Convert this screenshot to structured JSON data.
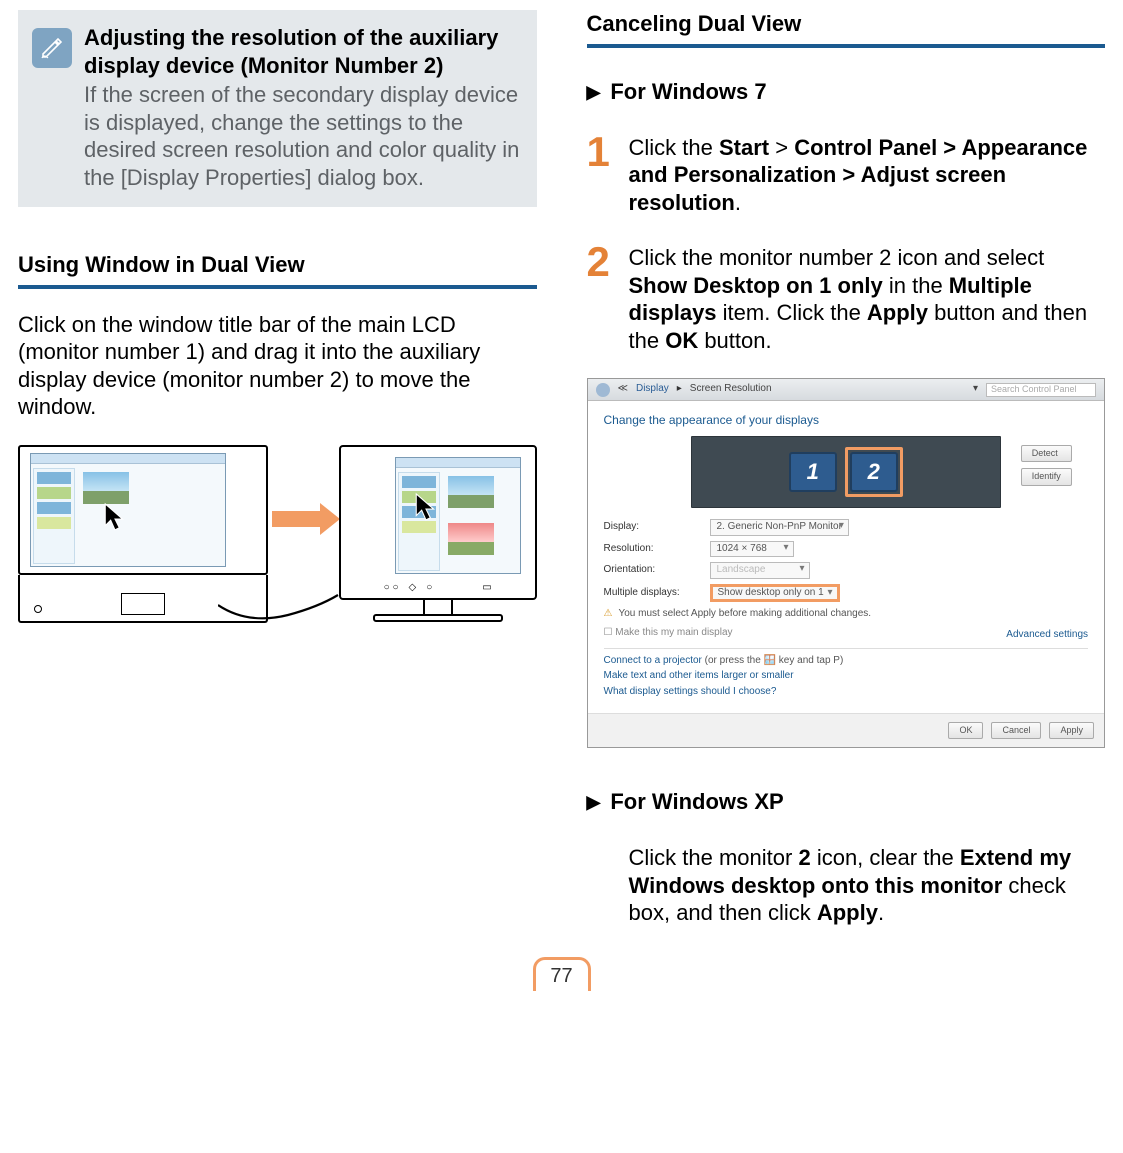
{
  "left": {
    "note": {
      "title": "Adjusting the resolution of the auxiliary display device  (Monitor Number 2)",
      "body": "If the screen of the secondary display device is displayed, change the settings to the desired screen resolution and color quality in the [Display Properties] dialog box."
    },
    "heading": "Using Window in Dual View",
    "body": "Click on the window title bar of the main LCD (monitor number 1) and drag it into the auxiliary display device (monitor number 2) to move the window."
  },
  "right": {
    "heading": "Canceling Dual View",
    "win7": {
      "label": "For Windows 7",
      "step1_num": "1",
      "step1_pre": "Click the ",
      "step1_b1": "Start",
      "step1_sep": " > ",
      "step1_b2": "Control Panel > Appearance and Personalization > Adjust screen resolution",
      "step1_post": ".",
      "step2_num": "2",
      "step2_t1": "Click the monitor number 2 icon and select ",
      "step2_b1": "Show Desktop on 1 only",
      "step2_t2": " in the ",
      "step2_b2": "Multiple displays",
      "step2_t3": " item. Click the ",
      "step2_b3": "Apply",
      "step2_t4": " button and then the ",
      "step2_b4": "OK",
      "step2_t5": " button."
    },
    "screenshot": {
      "bc1": "Display",
      "bc2": "Screen Resolution",
      "search_ph": "Search Control Panel",
      "heading": "Change the appearance of your displays",
      "mon1": "1",
      "mon2": "2",
      "detect": "Detect",
      "identify": "Identify",
      "lbl_display": "Display:",
      "val_display": "2. Generic Non-PnP Monitor",
      "lbl_resolution": "Resolution:",
      "val_resolution": "1024 × 768",
      "lbl_orientation": "Orientation:",
      "val_orientation": "Landscape",
      "lbl_multiple": "Multiple displays:",
      "val_multiple": "Show desktop only on 1",
      "warn": "You must select Apply before making additional changes.",
      "chk_main": "Make this my main display",
      "adv": "Advanced settings",
      "link_proj_pre": "Connect to a projector",
      "link_proj_post": " (or press the 🪟 key and tap P)",
      "link_text": "Make text and other items larger or smaller",
      "link_what": "What display settings should I choose?",
      "btn_ok": "OK",
      "btn_cancel": "Cancel",
      "btn_apply": "Apply"
    },
    "winxp": {
      "label": "For Windows XP",
      "t1": "Click the monitor ",
      "b1": "2",
      "t2": " icon, clear the ",
      "b2": "Extend my Windows desktop onto this monitor",
      "t3": " check box, and then click ",
      "b3": "Apply",
      "t4": "."
    }
  },
  "page": "77"
}
